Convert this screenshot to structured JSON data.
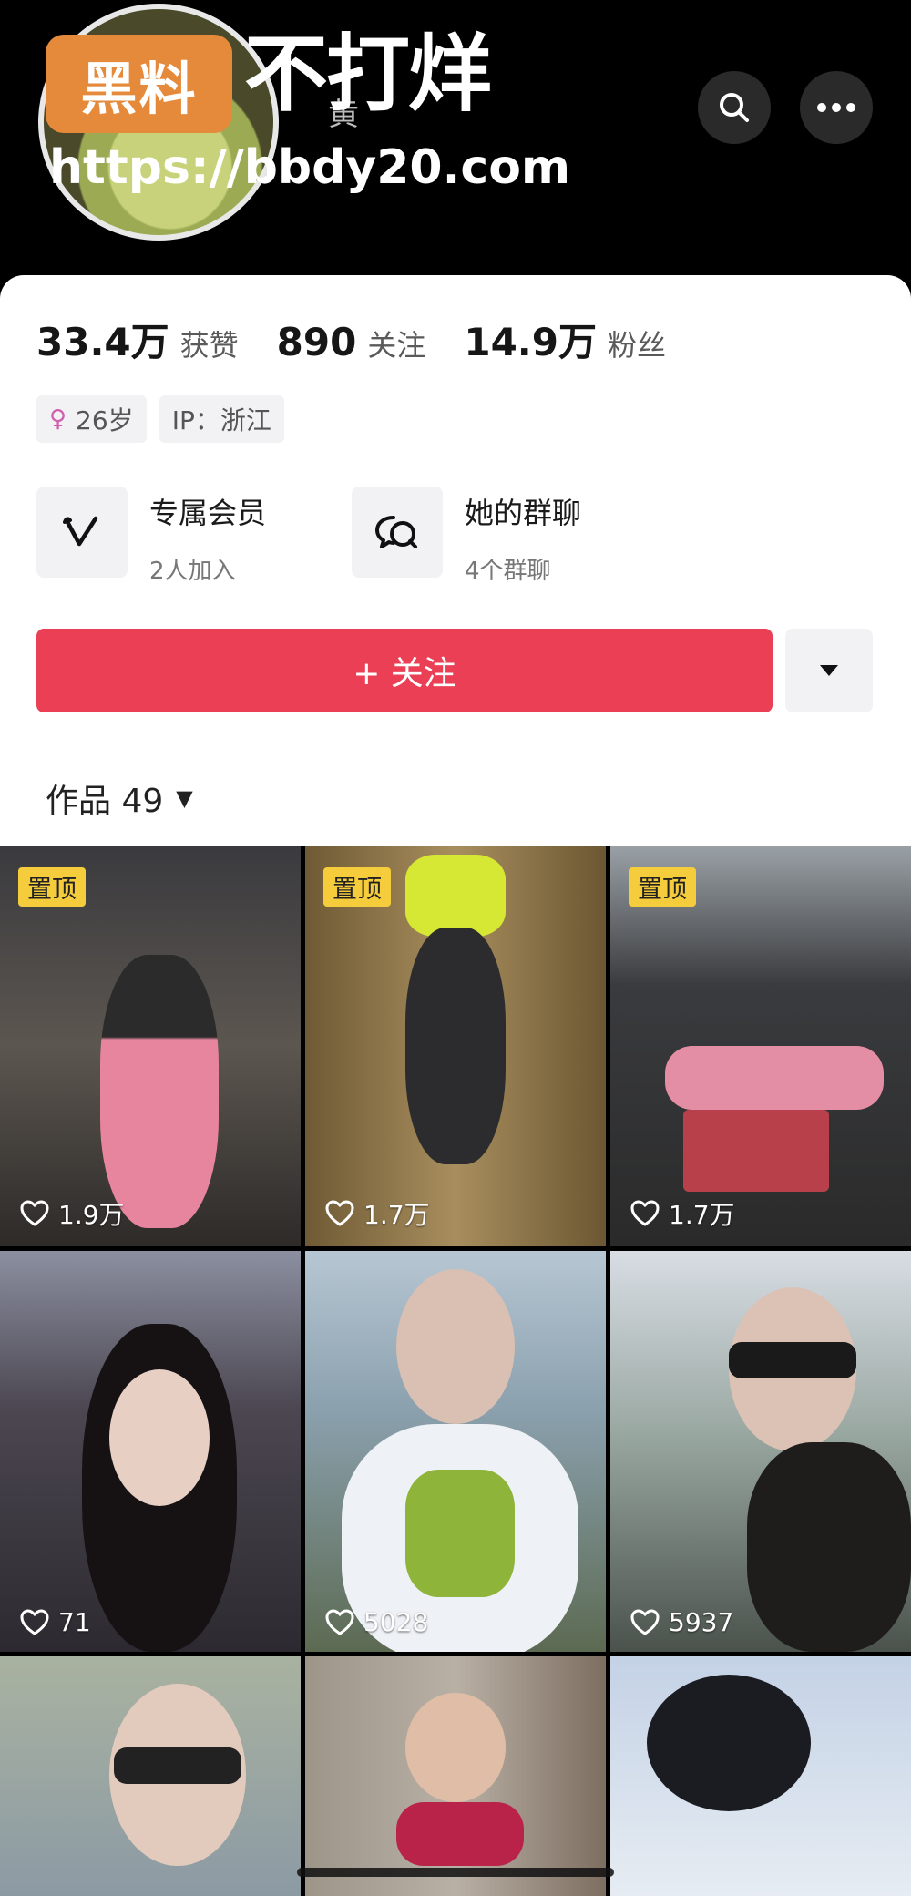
{
  "watermark": {
    "badge": "黑料",
    "slogan": "不打烊",
    "url": "https://bbdy20.com"
  },
  "profile": {
    "name_partial": "黄",
    "stats": [
      {
        "value": "33.4万",
        "label": "获赞"
      },
      {
        "value": "890",
        "label": "关注"
      },
      {
        "value": "14.9万",
        "label": "粉丝"
      }
    ],
    "tags": {
      "gender_icon": "female-icon",
      "age": "26岁",
      "ip": "IP：浙江"
    },
    "features": {
      "vip": {
        "title": "专属会员",
        "sub": "2人加入",
        "icon": "v-icon"
      },
      "group": {
        "title": "她的群聊",
        "sub": "4个群聊",
        "icon": "chat-icon"
      }
    },
    "follow_label": "+ 关注",
    "works_tab": "作品 49"
  },
  "colors": {
    "follow": "#ea3f55",
    "pin": "#f5cc3b",
    "gender": "#d05fb0"
  },
  "videos": [
    {
      "pinned": "置顶",
      "likes": "1.9万"
    },
    {
      "pinned": "置顶",
      "likes": "1.7万"
    },
    {
      "pinned": "置顶",
      "likes": "1.7万"
    },
    {
      "pinned": "",
      "likes": "71"
    },
    {
      "pinned": "",
      "likes": "5028"
    },
    {
      "pinned": "",
      "likes": "5937"
    },
    {
      "pinned": "",
      "likes": ""
    },
    {
      "pinned": "",
      "likes": ""
    },
    {
      "pinned": "",
      "likes": ""
    }
  ]
}
